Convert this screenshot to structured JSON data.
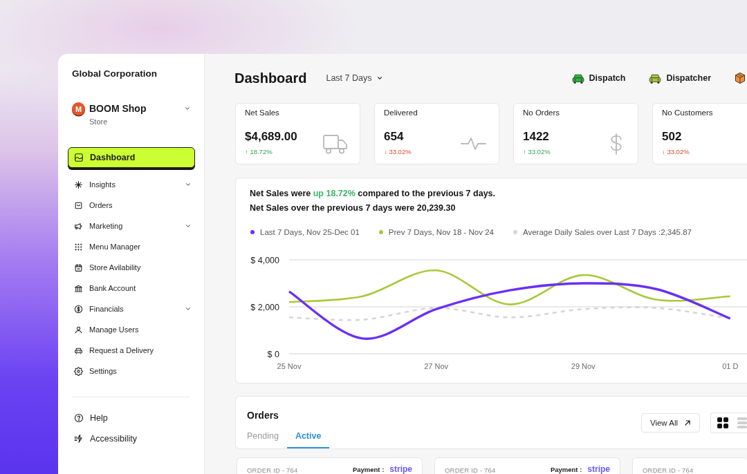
{
  "sidebar": {
    "org_name": "Global Corporation",
    "store": {
      "initial": "M",
      "name": "BOOM Shop",
      "subtitle": "Store"
    },
    "nav": [
      {
        "label": "Dashboard",
        "selected": true,
        "expandable": false
      },
      {
        "label": "Insights",
        "selected": false,
        "expandable": true
      },
      {
        "label": "Orders",
        "selected": false,
        "expandable": false
      },
      {
        "label": "Marketing",
        "selected": false,
        "expandable": true
      },
      {
        "label": "Menu Manager",
        "selected": false,
        "expandable": false
      },
      {
        "label": "Store Avilability",
        "selected": false,
        "expandable": false
      },
      {
        "label": "Bank Account",
        "selected": false,
        "expandable": false
      },
      {
        "label": "Financials",
        "selected": false,
        "expandable": true
      },
      {
        "label": "Manage Users",
        "selected": false,
        "expandable": false
      },
      {
        "label": "Request a Delivery",
        "selected": false,
        "expandable": false
      },
      {
        "label": "Settings",
        "selected": false,
        "expandable": false
      }
    ],
    "footer_nav": [
      {
        "label": "Help"
      },
      {
        "label": "Accessibility"
      }
    ]
  },
  "header": {
    "title": "Dashboard",
    "date_range": "Last 7 Days",
    "quick_actions": [
      {
        "label": "Dispatch",
        "color": "#2db83d"
      },
      {
        "label": "Dispatcher",
        "color": "#a9c93c"
      },
      {
        "color": "#f0913a"
      }
    ]
  },
  "stats": [
    {
      "title": "Net Sales",
      "value": "$4,689.00",
      "change": "↑ 18.72%",
      "positive": true
    },
    {
      "title": "Delivered",
      "value": "654",
      "change": "↓ 33.02%",
      "positive": false
    },
    {
      "title": "No Orders",
      "value": "1422",
      "change": "↑ 33.02%",
      "positive": true
    },
    {
      "title": "No Customers",
      "value": "502",
      "change": "↓ 33.02%",
      "positive": false
    }
  ],
  "sales_panel": {
    "summary": [
      {
        "segments": [
          {
            "text": "Net Sales were ",
            "highlight": false
          },
          {
            "text": "up 18.72%",
            "highlight": true
          },
          {
            "text": " compared to the previous 7 days.",
            "highlight": false
          }
        ]
      },
      {
        "segments": [
          {
            "text": "Net Sales over the previous 7 days were 20,239.30",
            "highlight": false
          }
        ]
      }
    ],
    "chart_data": {
      "type": "line",
      "categories": [
        "25 Nov",
        null,
        "27 Nov",
        null,
        "29 Nov",
        null,
        "01 D"
      ],
      "series": [
        {
          "name": "Last 7 Days, Nov 25-Dec 01",
          "color": "#6a2ff5",
          "line_style": "solid",
          "values": [
            2650,
            650,
            1900,
            2700,
            3000,
            2750,
            1500
          ]
        },
        {
          "name": "Prev 7 Days, Nov 18 - Nov 24",
          "color": "#a8c93a",
          "line_style": "solid",
          "values": [
            2200,
            2450,
            3550,
            2100,
            3350,
            2300,
            2450
          ]
        },
        {
          "name": "Average Daily Sales over Last 7 Days :2,345.87",
          "color": "#d6d6d6",
          "line_style": "dashed",
          "values": [
            1550,
            1450,
            1950,
            1550,
            1900,
            1950,
            1500
          ]
        }
      ],
      "ylim": [
        0,
        4000
      ],
      "yticks": [
        {
          "value": 0,
          "label": "$ 0"
        },
        {
          "value": 2000,
          "label": "$ 2,000"
        },
        {
          "value": 4000,
          "label": "$ 4,000"
        }
      ]
    }
  },
  "orders": {
    "title": "Orders",
    "tabs": [
      {
        "label": "Pending",
        "selected": false
      },
      {
        "label": "Active",
        "selected": true
      }
    ],
    "view_all": "View All",
    "view_modes": [
      {
        "kind": "grid",
        "selected": true
      },
      {
        "kind": "list",
        "selected": false
      }
    ],
    "cards": [
      {
        "order_id": "ORDER ID - 764",
        "payment_label": "Payment :",
        "payment_method": "stripe"
      },
      {
        "order_id": "ORDER ID - 764",
        "payment_label": "Payment :",
        "payment_method": "stripe"
      },
      {
        "order_id": "ORDER ID - 764"
      }
    ]
  }
}
